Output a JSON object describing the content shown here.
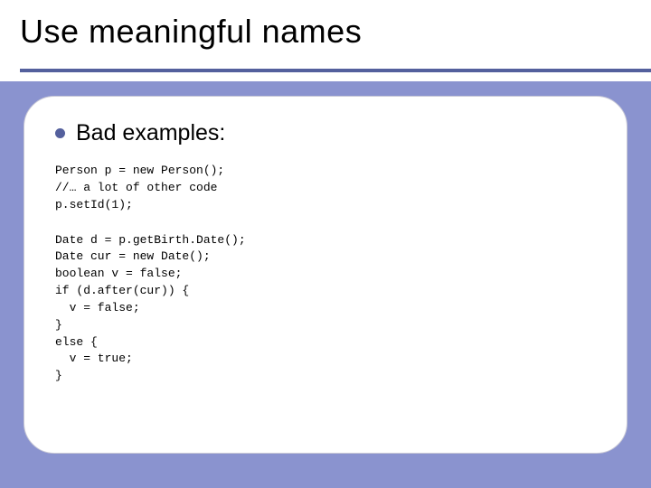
{
  "title": "Use meaningful names",
  "bullet": "Bad examples:",
  "code1": "Person p = new Person();\n//… a lot of other code\np.setId(1);",
  "code2": "Date d = p.getBirth.Date();\nDate cur = new Date();\nboolean v = false;\nif (d.after(cur)) {\n  v = false;\n}\nelse {\n  v = true;\n}"
}
